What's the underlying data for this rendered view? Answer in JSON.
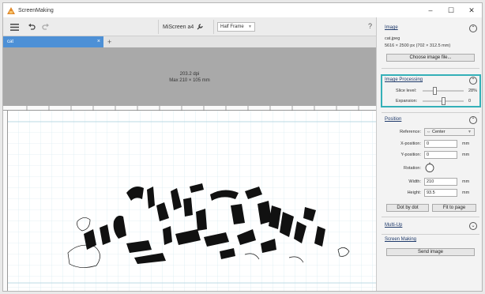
{
  "window": {
    "title": "ScreenMaking",
    "minimize": "–",
    "maximize": "☐",
    "close": "✕"
  },
  "toolbar": {
    "menu_icon": "hamburger-icon",
    "undo_icon": "undo-icon",
    "redo_icon": "redo-icon",
    "device": "MiScreen a4",
    "device_icon": "wrench-icon",
    "frame_select": "Half Frame",
    "help": "?"
  },
  "tabs": [
    {
      "label": "cat",
      "close": "×"
    }
  ],
  "tab_add": "+",
  "canvas": {
    "dpi": "203.2 dpi",
    "max": "Max 210 × 105 mm"
  },
  "panel": {
    "image": {
      "title": "Image",
      "toggle": "⌃",
      "filename": "cat.jpeg",
      "size": "5616 × 2500 px (702 × 312.5 mm)",
      "choose_button": "Choose image file..."
    },
    "processing": {
      "title": "Image Processing",
      "toggle": "⌃",
      "slice_label": "Slice level:",
      "slice_value": "28%",
      "slice_fraction": 0.28,
      "expansion_label": "Expansion:",
      "expansion_value": "0",
      "expansion_fraction": 0.5
    },
    "position": {
      "title": "Position",
      "toggle": "⌃",
      "reference_label": "Reference:",
      "reference_value": "⇔ Center",
      "xpos_label": "X-position:",
      "xpos_value": "0",
      "ypos_label": "Y-position:",
      "ypos_value": "0",
      "unit": "mm",
      "rotation_label": "Rotation:",
      "width_label": "Width:",
      "width_value": "210",
      "height_label": "Height:",
      "height_value": "93.5",
      "dot_button": "Dot by dot",
      "fit_button": "Fit to page"
    },
    "multiup": {
      "title": "Multi-Up",
      "toggle": "⌄"
    },
    "screenmaking": {
      "title": "Screen Making",
      "send_button": "Send image"
    }
  }
}
